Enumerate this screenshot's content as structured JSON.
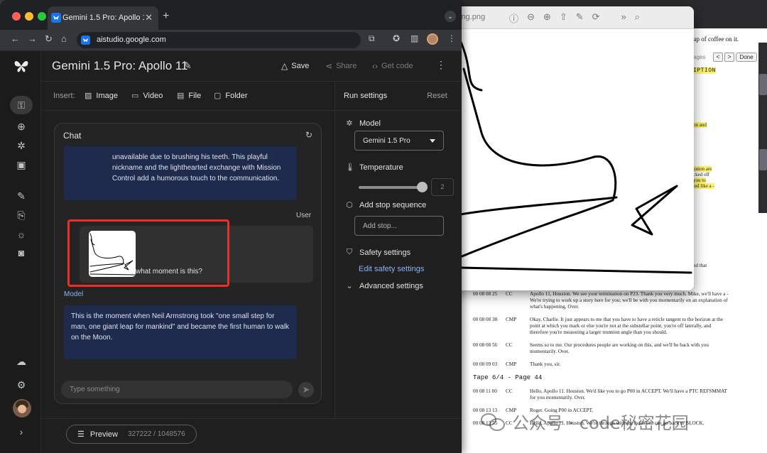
{
  "browser": {
    "tab_title": "Gemini 1.5 Pro: Apollo 11 | Goo",
    "url": "aistudio.google.com"
  },
  "app": {
    "title": "Gemini 1.5 Pro: Apollo 11",
    "header": {
      "save": "Save",
      "share": "Share",
      "get_code": "Get code"
    },
    "insert": {
      "label": "Insert:",
      "image": "Image",
      "video": "Video",
      "file": "File",
      "folder": "Folder"
    },
    "chat": {
      "title": "Chat",
      "prev_model_text": "unavailable due to brushing his teeth. This playful nickname and the lighthearted exchange with Mission Control add a humorous touch to the communication.",
      "user_label": "User",
      "user_text": "what moment is this?",
      "model_label": "Model",
      "model_text": "This is the moment when Neil Armstrong took \"one small step for man, one giant leap for mankind\" and became the first human to walk on the Moon.",
      "input_placeholder": "Type something"
    },
    "footer": {
      "preview": "Preview",
      "token_count": "327222 / 1048576"
    },
    "settings": {
      "title": "Run settings",
      "reset": "Reset",
      "model_label": "Model",
      "model_value": "Gemini 1.5 Pro",
      "temperature_label": "Temperature",
      "temperature_value": "2",
      "temperature_fraction": 1.0,
      "stop_label": "Add stop sequence",
      "stop_placeholder": "Add stop...",
      "safety_label": "Safety settings",
      "safety_link": "Edit safety settings",
      "advanced_label": "Advanced settings"
    }
  },
  "viewer": {
    "title": "ing.png"
  },
  "document": {
    "top_caption": "up of coffee on it.",
    "pages_label": "ages",
    "nav_prev": "<",
    "nav_next": ">",
    "done": "Done",
    "section_head": "IPTION",
    "side_fragments": [
      "on and",
      "union are",
      "cked off",
      "you to",
      "ted like a -",
      "nd that"
    ],
    "transcript_a": [
      {
        "time": "00 08 08 25",
        "who": "CC",
        "text": "Apollo 11, Houston. We see your termination on P23. Thank you very much. Mike, we'll have a - We're trying to work up a story here for you; we'll be with you momentarily on an explanation of what's happening. Over."
      },
      {
        "time": "00 08 08 38",
        "who": "CMP",
        "text": "Okay, Charlie. It just appears to me that you have to have a reticle tangent to the horizon at the point at which you mark or else you're not at the substellar point; you're off laterally, and therefore you're measuring a larger trunnion angle than you should."
      },
      {
        "time": "00 08 08 56",
        "who": "CC",
        "text": "Seems so to me. Our procedures people are working on this, and we'll be back with you momentarily. Over."
      },
      {
        "time": "00 08 09 03",
        "who": "CMP",
        "text": "Thank you, sir."
      }
    ],
    "tape_head": "Tape 6/4 - Page 44",
    "transcript_b": [
      {
        "time": "00 08 11 00",
        "who": "CC",
        "text": "Hello, Apollo 11. Houston. We'd like you to go P00 in ACCEPT. We'll have a PTC REFSMMAT for you momentarily. Over."
      },
      {
        "time": "00 08 13 13",
        "who": "CMP",
        "text": "Roger. Going P00 in ACCEPT."
      },
      {
        "time": "00 08 13 55",
        "who": "CC",
        "text": "Hello, Apollo 11. Houston. We're through with the load. You can go back to BLOCK."
      }
    ]
  },
  "watermark": {
    "text": "公众号 · code秘密花园"
  }
}
